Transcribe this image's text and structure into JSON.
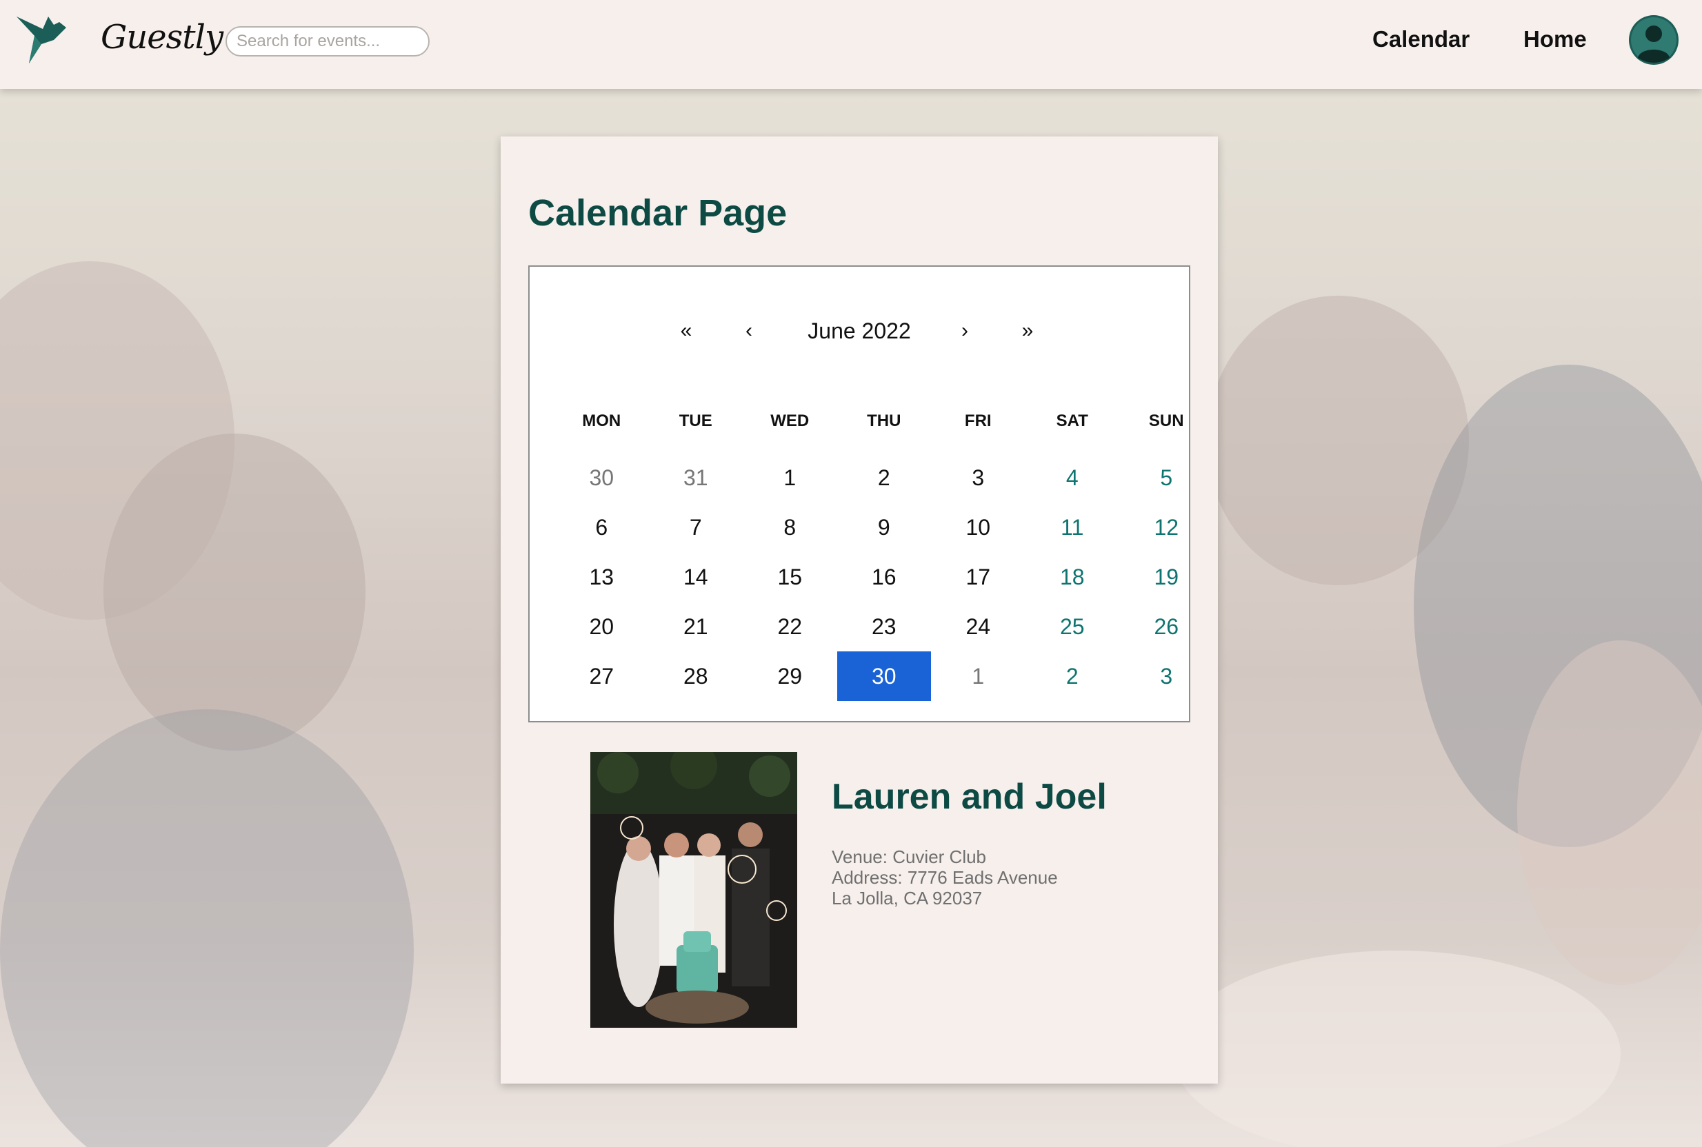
{
  "navbar": {
    "brand": "Guestly",
    "logo_icon": "bird-logo-icon",
    "search_placeholder": "Search for events...",
    "links": [
      "Calendar",
      "Home"
    ],
    "avatar_icon": "user-avatar-icon"
  },
  "page": {
    "title": "Calendar Page"
  },
  "calendar": {
    "nav": {
      "first": "«",
      "prev": "‹",
      "label": "June 2022",
      "next": "›",
      "last": "»"
    },
    "weekdays": [
      "MON",
      "TUE",
      "WED",
      "THU",
      "FRI",
      "SAT",
      "SUN"
    ],
    "weeks": [
      [
        "30",
        "31",
        "1",
        "2",
        "3",
        "4",
        "5"
      ],
      [
        "6",
        "7",
        "8",
        "9",
        "10",
        "11",
        "12"
      ],
      [
        "13",
        "14",
        "15",
        "16",
        "17",
        "18",
        "19"
      ],
      [
        "20",
        "21",
        "22",
        "23",
        "24",
        "25",
        "26"
      ],
      [
        "27",
        "28",
        "29",
        "30",
        "1",
        "2",
        "3"
      ]
    ],
    "selected_day": "30",
    "colors": {
      "selected": "#1a63d6",
      "weekend": "#0e7470",
      "other_month": "#767676"
    }
  },
  "event": {
    "name": "Lauren and Joel",
    "venue": "Venue: Cuvier Club",
    "address": "Address: 7776 Eads Avenue",
    "city": "La Jolla, CA 92037",
    "photo": "wedding-photo"
  },
  "colors": {
    "primary": "#0d4a44",
    "nav_bg": "#f7efec",
    "card_bg": "#f7efec"
  }
}
